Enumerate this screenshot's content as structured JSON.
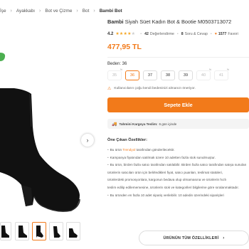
{
  "breadcrumb": {
    "items": [
      "İşe",
      "Ayakkabı",
      "Bot ve Çizme",
      "Bot",
      "Bambi Bot"
    ]
  },
  "product": {
    "brand": "Bambi",
    "name": "Siyah Süet Kadın Bot & Bootie M0503713072",
    "rating_score": "4.2",
    "rating_stars": 4,
    "review_count": "42",
    "review_label": "Değerlendirme",
    "qa_count": "8",
    "qa_label": "Soru & Cevap",
    "favorites": "1577",
    "favorites_label": "Favori",
    "price": "477,95 TL"
  },
  "size_selector": {
    "label": "Beden: 36",
    "sizes": [
      {
        "label": "35",
        "state": "disabled",
        "badge": "%"
      },
      {
        "label": "36",
        "state": "selected",
        "badge": ""
      },
      {
        "label": "37",
        "state": "normal",
        "badge": ""
      },
      {
        "label": "38",
        "state": "normal",
        "badge": ""
      },
      {
        "label": "39",
        "state": "normal",
        "badge": ""
      },
      {
        "label": "40",
        "state": "disabled",
        "badge": "%"
      },
      {
        "label": "41",
        "state": "disabled",
        "badge": "%"
      }
    ],
    "warning": "Kullanıcıların çoğu kendi bedeninizi almanızı öneriyor."
  },
  "actions": {
    "add_to_cart": "Sepete Ekle",
    "all_features": "ÜRÜNÜN TÜM ÖZELLİKLERİ"
  },
  "delivery": {
    "label": "Tahmini Kargoya Teslim:",
    "value": "6 gün içinde"
  },
  "features": {
    "title": "Öne Çıkan Özellikler:",
    "items": [
      {
        "prefix": "Bu ürün ",
        "link": "Trendyol",
        "suffix": " tarafından gönderilecektir.",
        "bullet": true
      },
      {
        "prefix": "Kampanya fiyatından satılmak üzere 10 adetten fazla stok sunulmuştur.",
        "link": "",
        "suffix": "",
        "bullet": true
      },
      {
        "prefix": "Bu ürün, birden fazla satıcı tarafından satılabilir. Birden fazla satıcı tarafından satışa sunulan",
        "link": "",
        "suffix": "",
        "bullet": true
      },
      {
        "prefix": "ürünlerin satıcıları ürün için belirledikleri fiyat, satıcı puanları, teslimat statüleri,",
        "link": "",
        "suffix": "",
        "bullet": false
      },
      {
        "prefix": "ürünlerdeki promosyonlara, kargonun bedava olup olmamasına ve ürünlerin hızlı",
        "link": "",
        "suffix": "",
        "bullet": false
      },
      {
        "prefix": "teslim edilip edilememesine, ürünlerin stok ve kategorileri bilgilerine göre sıralanmaktadır.",
        "link": "",
        "suffix": "",
        "bullet": false
      },
      {
        "prefix": "Bu üründen en fazla 10 adet sipariş verilebilir. 10 adedin üzerindeki siparişleri",
        "link": "",
        "suffix": "",
        "bullet": true
      }
    ]
  },
  "colors": {
    "accent": "#f27a1a",
    "star": "#f5a623"
  }
}
